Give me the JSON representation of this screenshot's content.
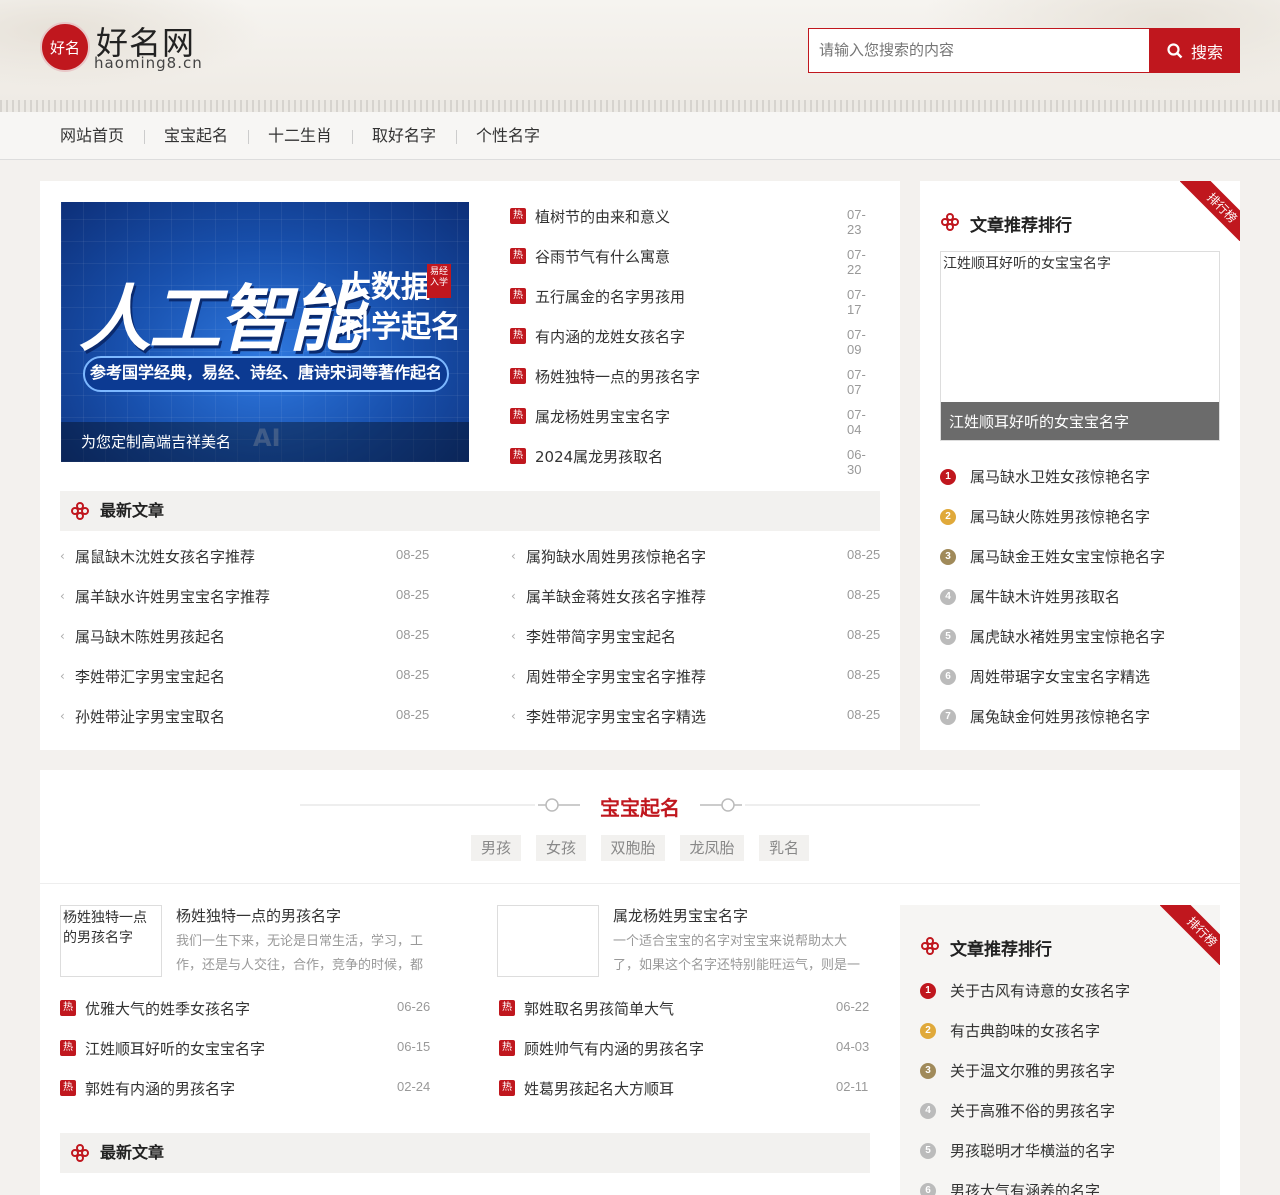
{
  "brand": {
    "title": "好名网",
    "domain": "haoming8.cn",
    "logo_char": "好名"
  },
  "search": {
    "placeholder": "请输入您搜索的内容",
    "button": "搜索"
  },
  "nav": [
    "网站首页",
    "宝宝起名",
    "十二生肖",
    "取好名字",
    "个性名字"
  ],
  "hero": {
    "headline": "人工智能",
    "side_line1": "大数据",
    "side_line2": "科学起名",
    "stamp": "易经入学",
    "band": "参考国学经典，易经、诗经、唐诗宋词等著作起名",
    "watermark": "AI",
    "caption": "为您定制高端吉祥美名"
  },
  "hot_badge": "热",
  "hot_list": [
    {
      "title": "植树节的由来和意义",
      "date": "07-23"
    },
    {
      "title": "谷雨节气有什么寓意",
      "date": "07-22"
    },
    {
      "title": "五行属金的名字男孩用",
      "date": "07-17"
    },
    {
      "title": "有内涵的龙姓女孩名字",
      "date": "07-09"
    },
    {
      "title": "杨姓独特一点的男孩名字",
      "date": "07-07"
    },
    {
      "title": "属龙杨姓男宝宝名字",
      "date": "07-04"
    },
    {
      "title": "2024属龙男孩取名",
      "date": "06-30"
    }
  ],
  "latest": {
    "heading": "最新文章",
    "left": [
      {
        "title": "属鼠缺木沈姓女孩名字推荐",
        "date": "08-25"
      },
      {
        "title": "属羊缺水许姓男宝宝名字推荐",
        "date": "08-25"
      },
      {
        "title": "属马缺木陈姓男孩起名",
        "date": "08-25"
      },
      {
        "title": "李姓带汇字男宝宝起名",
        "date": "08-25"
      },
      {
        "title": "孙姓带沚字男宝宝取名",
        "date": "08-25"
      }
    ],
    "right": [
      {
        "title": "属狗缺水周姓男孩惊艳名字",
        "date": "08-25"
      },
      {
        "title": "属羊缺金蒋姓女孩名字推荐",
        "date": "08-25"
      },
      {
        "title": "李姓带简字男宝宝起名",
        "date": "08-25"
      },
      {
        "title": "周姓带全字男宝宝名字推荐",
        "date": "08-25"
      },
      {
        "title": "李姓带泥字男宝宝名字精选",
        "date": "08-25"
      }
    ]
  },
  "rank1": {
    "ribbon": "排行榜",
    "title": "文章推荐排行",
    "featured_alt": "江姓顺耳好听的女宝宝名字",
    "featured_caption": "江姓顺耳好听的女宝宝名字",
    "items": [
      "属马缺水卫姓女孩惊艳名字",
      "属马缺火陈姓男孩惊艳名字",
      "属马缺金王姓女宝宝惊艳名字",
      "属牛缺木许姓男孩取名",
      "属虎缺水褚姓男宝宝惊艳名字",
      "周姓带琚字女宝宝名字精选",
      "属兔缺金何姓男孩惊艳名字"
    ]
  },
  "section2": {
    "title": "宝宝起名",
    "tags": [
      "男孩",
      "女孩",
      "双胞胎",
      "龙凤胎",
      "乳名"
    ],
    "cards": [
      {
        "thumb": "杨姓独特一点的男孩名字",
        "title": "杨姓独特一点的男孩名字",
        "desc": "我们一生下来，无论是日常生活，学习，工作，还是与人交往，合作，竞争的时候，都"
      },
      {
        "thumb": "",
        "title": "属龙杨姓男宝宝名字",
        "desc": "一个适合宝宝的名字对宝宝来说帮助太大了，如果这个名字还特别能旺运气，则是一"
      }
    ],
    "hot_left": [
      {
        "title": "优雅大气的姓季女孩名字",
        "date": "06-26"
      },
      {
        "title": "江姓顺耳好听的女宝宝名字",
        "date": "06-15"
      },
      {
        "title": "郭姓有内涵的男孩名字",
        "date": "02-24"
      }
    ],
    "hot_right": [
      {
        "title": "郭姓取名男孩简单大气",
        "date": "06-22"
      },
      {
        "title": "顾姓帅气有内涵的男孩名字",
        "date": "04-03"
      },
      {
        "title": "姓葛男孩起名大方顺耳",
        "date": "02-11"
      }
    ],
    "latest_heading": "最新文章"
  },
  "rank2": {
    "ribbon": "排行榜",
    "title": "文章推荐排行",
    "items": [
      "关于古风有诗意的女孩名字",
      "有古典韵味的女孩名字",
      "关于温文尔雅的男孩名字",
      "关于高雅不俗的男孩名字",
      "男孩聪明才华横溢的名字",
      "男孩大气有涵养的名字"
    ]
  },
  "colors": {
    "accent": "#c0171e",
    "gold": "#e0a93a",
    "bronze": "#a08a5a",
    "gray": "#bbbbbb"
  }
}
